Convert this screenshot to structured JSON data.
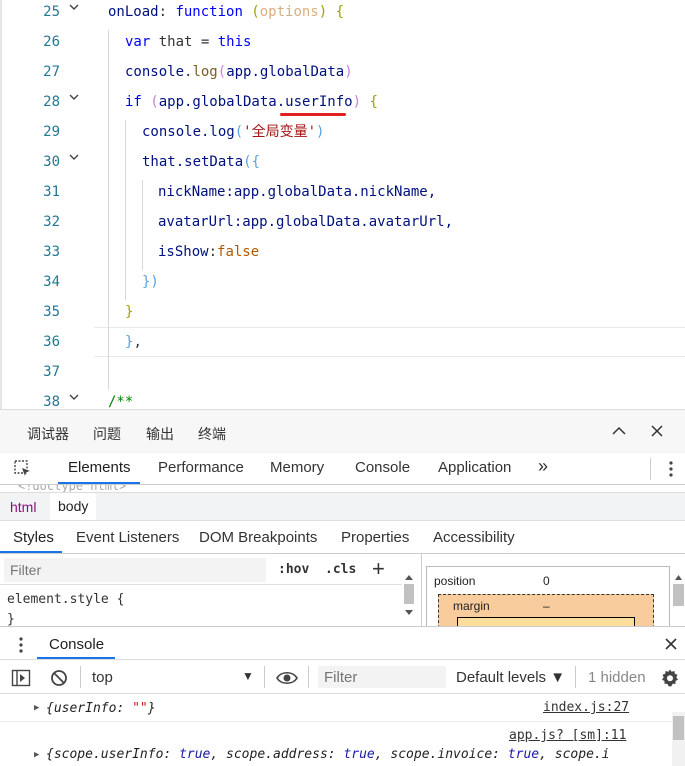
{
  "editor": {
    "lines": [
      {
        "num": "25",
        "fold": true
      },
      {
        "num": "26",
        "fold": false
      },
      {
        "num": "27",
        "fold": false
      },
      {
        "num": "28",
        "fold": true
      },
      {
        "num": "29",
        "fold": false
      },
      {
        "num": "30",
        "fold": true
      },
      {
        "num": "31",
        "fold": false
      },
      {
        "num": "32",
        "fold": false
      },
      {
        "num": "33",
        "fold": false
      },
      {
        "num": "34",
        "fold": false
      },
      {
        "num": "35",
        "fold": false
      },
      {
        "num": "36",
        "fold": false
      },
      {
        "num": "37",
        "fold": false
      },
      {
        "num": "38",
        "fold": true
      }
    ],
    "code": {
      "l25_a": "onLoad",
      "l25_b": ": ",
      "l25_c": "function",
      "l25_d": " (",
      "l25_e": "options",
      "l25_f": ") {",
      "l26_a": "var",
      "l26_b": " that = ",
      "l26_c": "this",
      "l27_a": "console",
      "l27_b": ".",
      "l27_c": "log",
      "l27_d": "(",
      "l27_e": "app.globalData",
      "l27_f": ")",
      "l28_a": "if",
      "l28_b": " (",
      "l28_c": "app.globalData.",
      "l28_d": "userInfo",
      "l28_e": ") ",
      "l28_f": "{",
      "l29_a": "console.log",
      "l29_b": "(",
      "l29_c": "'全局变量'",
      "l29_d": ")",
      "l30_a": "that.setData",
      "l30_b": "({",
      "l31_a": "nickName",
      "l31_b": ":app.globalData.nickName,",
      "l32_a": "avatarUrl",
      "l32_b": ":app.globalData.avatarUrl,",
      "l33_a": "isShow",
      "l33_b": ":",
      "l33_c": "false",
      "l34_a": "})",
      "l35_a": "}",
      "l36_a": "},",
      "l38_a": "/**"
    }
  },
  "devtools": {
    "top_tabs": [
      "调试器",
      "问题",
      "输出",
      "终端"
    ],
    "main_tabs": [
      "Elements",
      "Performance",
      "Memory",
      "Console",
      "Application"
    ],
    "more_tabs": "»",
    "html_peek": "<!doctype html>",
    "breadcrumb": [
      "html",
      "body"
    ],
    "sub_tabs": [
      "Styles",
      "Event Listeners",
      "DOM Breakpoints",
      "Properties",
      "Accessibility"
    ],
    "styles": {
      "filter_placeholder": "Filter",
      "hov": ":hov",
      "cls": ".cls",
      "plus": "+",
      "element_style": "element.style {",
      "close_brace": "}"
    },
    "box_model": {
      "position_label": "position",
      "position_value": "0",
      "margin_label": "margin",
      "margin_value": "–"
    },
    "drawer": {
      "tab": "Console"
    },
    "console_toolbar": {
      "context": "top",
      "filter_placeholder": "Filter",
      "levels": "Default levels ▼",
      "hidden": "1 hidden"
    },
    "messages": [
      {
        "source": "index.js:27",
        "text_open": "{",
        "key1": "userInfo",
        "sep1": ": ",
        "val1": "\"\"",
        "text_close": "}"
      },
      {
        "source": "app.js? [sm]:11",
        "open": "{",
        "k1": "scope.userInfo",
        "v1": "true",
        "k2": "scope.address",
        "v2": "true",
        "k3": "scope.invoice",
        "v3": "true",
        "k4": "scope.i"
      }
    ]
  }
}
